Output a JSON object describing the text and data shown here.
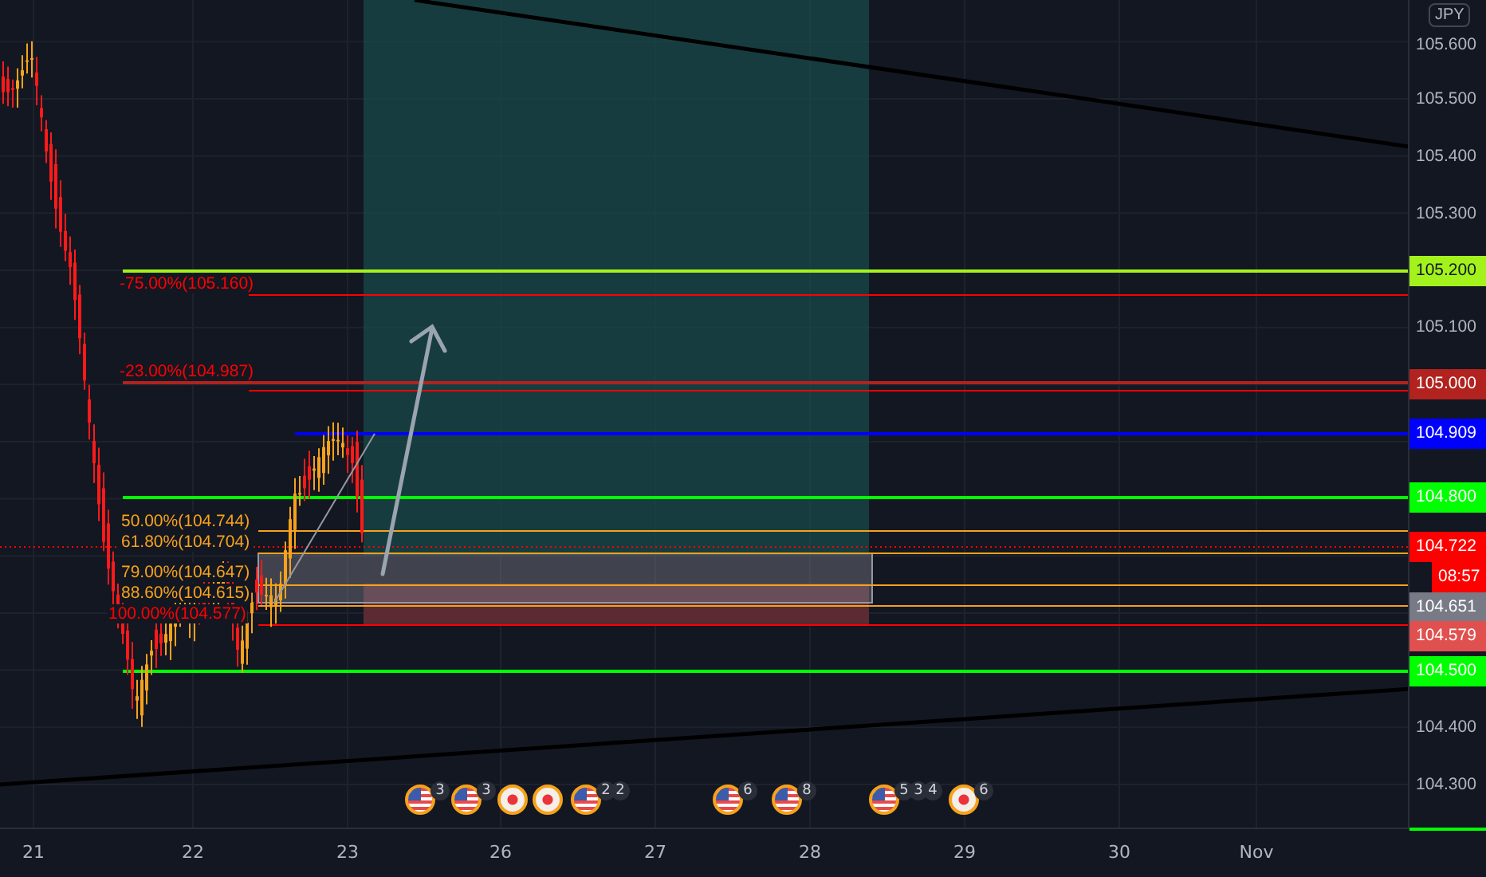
{
  "currency_button": "JPY",
  "price_axis": {
    "ticks": [
      "105.600",
      "105.500",
      "105.400",
      "105.300",
      "105.100",
      "104.400",
      "104.300"
    ]
  },
  "price_tags": [
    {
      "text": "105.200",
      "color": "#a3f21c"
    },
    {
      "text": "105.000",
      "color": "#b2221e"
    },
    {
      "text": "104.909",
      "color": "#0000ff"
    },
    {
      "text": "104.800",
      "color": "#00ff00"
    },
    {
      "text": "104.722",
      "color": "#ff0000"
    },
    {
      "text": "08:57",
      "color": "#ff0000"
    },
    {
      "text": "104.651",
      "color": "#787b86"
    },
    {
      "text": "104.579",
      "color": "#e0504f"
    },
    {
      "text": "104.500",
      "color": "#00ff00"
    }
  ],
  "fib_labels": [
    {
      "text": "-75.00%(105.160)",
      "color": "#ff0000"
    },
    {
      "text": "-23.00%(104.987)",
      "color": "#ff0000"
    },
    {
      "text": "50.00%(104.744)",
      "color": "#f7a21b"
    },
    {
      "text": "61.80%(104.704)",
      "color": "#f7a21b"
    },
    {
      "text": "79.00%(104.647)",
      "color": "#f7a21b"
    },
    {
      "text": "88.60%(104.615)",
      "color": "#f7a21b"
    },
    {
      "text": "100.00%(104.577)",
      "color": "#ff0000"
    }
  ],
  "events": [
    {
      "kind": "flag",
      "badges": [
        "3"
      ]
    },
    {
      "kind": "flag",
      "badges": [
        "3"
      ]
    },
    {
      "kind": "dot"
    },
    {
      "kind": "dot"
    },
    {
      "kind": "flag",
      "badges": [
        "2",
        "2"
      ]
    },
    {
      "kind": "flag",
      "badges": [
        "6"
      ]
    },
    {
      "kind": "flag",
      "badges": [
        "8"
      ]
    },
    {
      "kind": "flag",
      "badges": [
        "5",
        "3",
        "4"
      ]
    },
    {
      "kind": "dot",
      "badges": [
        "6"
      ]
    }
  ],
  "time_axis": [
    "21",
    "22",
    "23",
    "26",
    "27",
    "28",
    "29",
    "30",
    "Nov"
  ]
}
